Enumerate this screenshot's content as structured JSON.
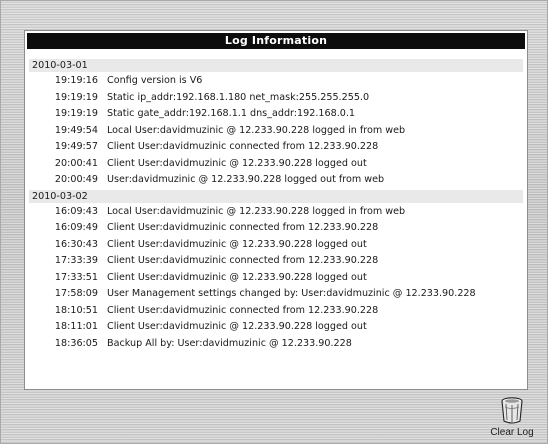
{
  "panel": {
    "title": "Log Information"
  },
  "log": {
    "days": [
      {
        "date": "2010-03-01",
        "entries": [
          {
            "time": "19:19:16",
            "message": "Config version is V6"
          },
          {
            "time": "19:19:19",
            "message": "Static ip_addr:192.168.1.180 net_mask:255.255.255.0"
          },
          {
            "time": "19:19:19",
            "message": "Static gate_addr:192.168.1.1 dns_addr:192.168.0.1"
          },
          {
            "time": "19:49:54",
            "message": "Local User:davidmuzinic @ 12.233.90.228 logged in from web"
          },
          {
            "time": "19:49:57",
            "message": "Client User:davidmuzinic connected from 12.233.90.228"
          },
          {
            "time": "20:00:41",
            "message": "Client User:davidmuzinic @ 12.233.90.228 logged out"
          },
          {
            "time": "20:00:49",
            "message": "User:davidmuzinic @ 12.233.90.228 logged out from web"
          }
        ]
      },
      {
        "date": "2010-03-02",
        "entries": [
          {
            "time": "16:09:43",
            "message": "Local User:davidmuzinic @ 12.233.90.228 logged in from web"
          },
          {
            "time": "16:09:49",
            "message": "Client User:davidmuzinic connected from 12.233.90.228"
          },
          {
            "time": "16:30:43",
            "message": "Client User:davidmuzinic @ 12.233.90.228 logged out"
          },
          {
            "time": "17:33:39",
            "message": "Client User:davidmuzinic connected from 12.233.90.228"
          },
          {
            "time": "17:33:51",
            "message": "Client User:davidmuzinic @ 12.233.90.228 logged out"
          },
          {
            "time": "17:58:09",
            "message": "User Management settings changed by: User:davidmuzinic @ 12.233.90.228"
          },
          {
            "time": "18:10:51",
            "message": "Client User:davidmuzinic connected from 12.233.90.228"
          },
          {
            "time": "18:11:01",
            "message": "Client User:davidmuzinic @ 12.233.90.228 logged out"
          },
          {
            "time": "18:36:05",
            "message": "Backup All by: User:davidmuzinic @ 12.233.90.228"
          }
        ]
      }
    ]
  },
  "actions": {
    "clear_log_label": "Clear Log",
    "clear_log_icon": "trash-can-icon"
  }
}
